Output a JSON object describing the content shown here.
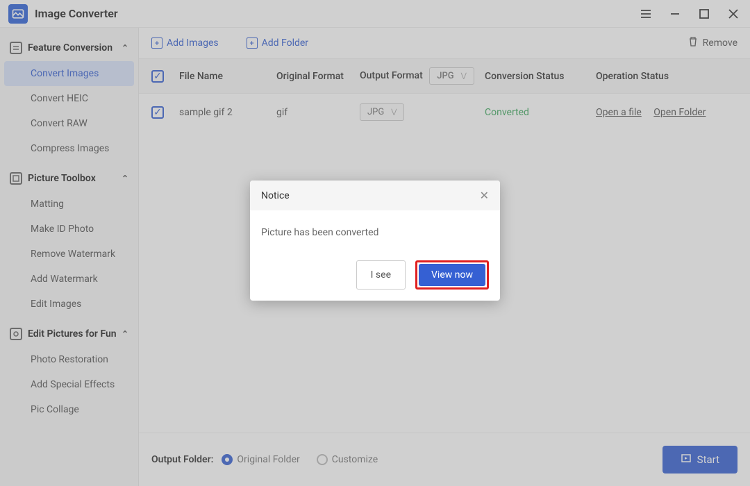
{
  "app": {
    "title": "Image Converter"
  },
  "sidebar": {
    "sections": [
      {
        "title": "Feature Conversion",
        "items": [
          "Convert Images",
          "Convert HEIC",
          "Convert RAW",
          "Compress Images"
        ]
      },
      {
        "title": "Picture Toolbox",
        "items": [
          "Matting",
          "Make ID Photo",
          "Remove Watermark",
          "Add Watermark",
          "Edit Images"
        ]
      },
      {
        "title": "Edit Pictures for Fun",
        "items": [
          "Photo Restoration",
          "Add Special Effects",
          "Pic Collage"
        ]
      }
    ]
  },
  "toolbar": {
    "add_images": "Add Images",
    "add_folder": "Add Folder",
    "remove": "Remove"
  },
  "table": {
    "headers": {
      "file_name": "File Name",
      "original_format": "Original Format",
      "output_format": "Output Format",
      "conversion_status": "Conversion Status",
      "operation_status": "Operation Status"
    },
    "header_output_select": "JPG",
    "rows": [
      {
        "name": "sample gif 2",
        "orig": "gif",
        "out": "JPG",
        "status": "Converted",
        "open_file": "Open a file",
        "open_folder": "Open Folder"
      }
    ]
  },
  "footer": {
    "label": "Output Folder:",
    "original": "Original Folder",
    "customize": "Customize",
    "start": "Start"
  },
  "modal": {
    "title": "Notice",
    "message": "Picture has been converted",
    "i_see": "I see",
    "view_now": "View now"
  }
}
